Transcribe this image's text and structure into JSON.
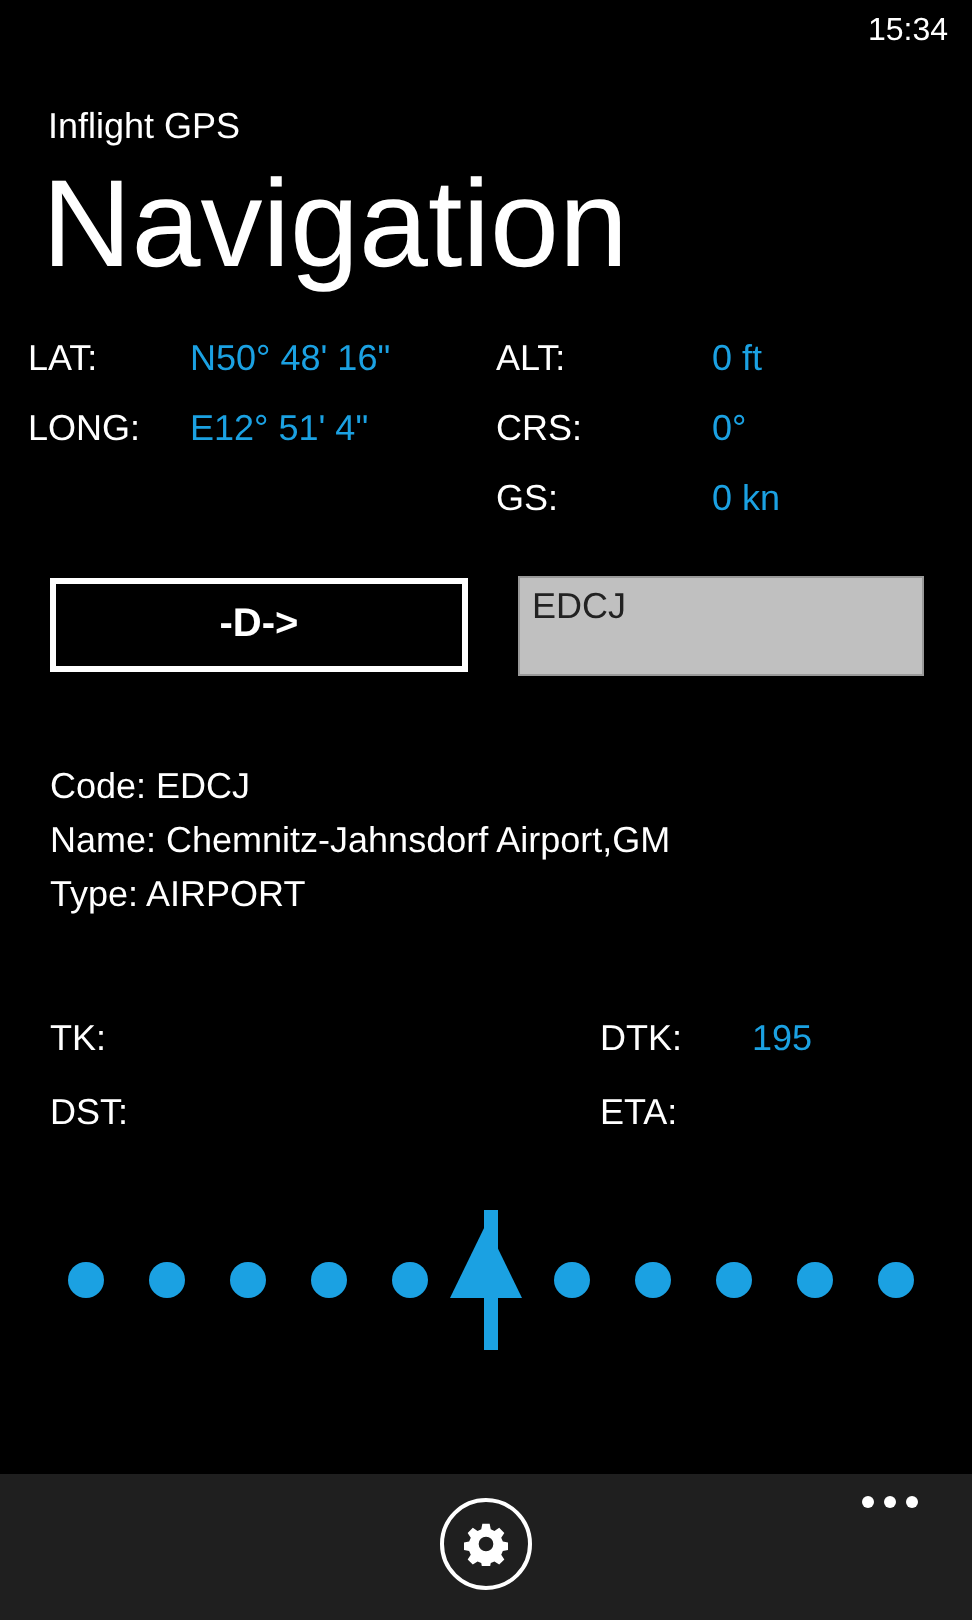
{
  "status_bar": {
    "time": "15:34"
  },
  "app_title": "Inflight GPS",
  "page_title": "Navigation",
  "position": [
    {
      "label": "LAT:",
      "value": "N50° 48' 16\""
    },
    {
      "label": "LONG:",
      "value": "E12° 51' 4\""
    }
  ],
  "flight": [
    {
      "label": "ALT:",
      "value": "0 ft"
    },
    {
      "label": "CRS:",
      "value": "0°"
    },
    {
      "label": "GS:",
      "value": "0 kn"
    }
  ],
  "direct_to_button": "-D->",
  "waypoint_field": {
    "value": "EDCJ"
  },
  "waypoint_info": [
    "Code: EDCJ",
    "Name: Chemnitz-Jahnsdorf Airport,GM",
    "Type: AIRPORT"
  ],
  "track": [
    {
      "label": "TK:",
      "right_label": "DTK:",
      "right_value": "195"
    },
    {
      "label": "DST:",
      "right_label": "ETA:"
    }
  ],
  "cdi": {
    "level": 0.5
  }
}
